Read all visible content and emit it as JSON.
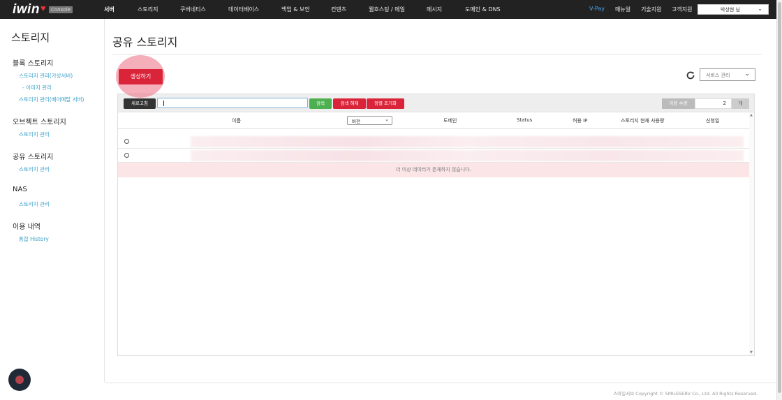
{
  "nav": {
    "logo": "iwin",
    "console_badge": "Console",
    "menu": [
      {
        "label": "서버",
        "active": true
      },
      {
        "label": "스토리지"
      },
      {
        "label": "쿠버네티스"
      },
      {
        "label": "데이터베이스"
      },
      {
        "label": "백업 & 보안"
      },
      {
        "label": "컨텐츠"
      },
      {
        "label": "웹호스팅 / 메일"
      },
      {
        "label": "메시지"
      },
      {
        "label": "도메인 & DNS"
      }
    ],
    "vpay": "V-Pay",
    "right_links": [
      "매뉴얼",
      "기술지원",
      "고객지원"
    ],
    "user": "박상현 님"
  },
  "sidebar": {
    "title": "스토리지",
    "sections": [
      {
        "heading": "블록 스토리지",
        "links": [
          "스토리지 관리(가상서버)",
          "- 이미지 관리",
          "스토리지 관리(베어메탈 서버)"
        ]
      },
      {
        "heading": "오브젝트 스토리지",
        "links": [
          "스토리지 관리"
        ]
      },
      {
        "heading": "공유 스토리지",
        "links": [
          "스토리지 관리"
        ]
      },
      {
        "heading": "NAS",
        "links": [
          "스토리지 관리"
        ]
      },
      {
        "heading": "이용 내역",
        "links": [
          "통합 History"
        ]
      }
    ]
  },
  "main": {
    "title": "공유 스토리지",
    "create_button": "생성하기",
    "service_select": "서비스 관리",
    "toolbar": {
      "refresh_button": "새로고침",
      "search_value": "",
      "search_button": "검색",
      "clear_button": "검색 해제",
      "sort_reset_button": "정렬 초기화",
      "qty_label": "이용 수량",
      "qty_value": "2",
      "qty_unit": "개"
    },
    "table": {
      "columns": [
        "이름",
        "버전",
        "도메인",
        "Status",
        "허용 IP",
        "스토리지 현재 사용량",
        "신청일"
      ],
      "version_select": "버전",
      "rows": 2,
      "empty_message": "더 이상 데이터가 존재하지 않습니다."
    }
  },
  "footer": {
    "copyright": "스마일서브 Copyright © SMILESERV Co., Ltd. All Rights Reserved."
  },
  "colors": {
    "brand_red": "#d9243a",
    "search_green": "#4caf50",
    "link_blue": "#3aa0c8",
    "nav_bg": "#222222"
  },
  "icons": {
    "refresh": "refresh-icon",
    "chat": "chat-icon",
    "chevron": "chevron-down-icon"
  }
}
